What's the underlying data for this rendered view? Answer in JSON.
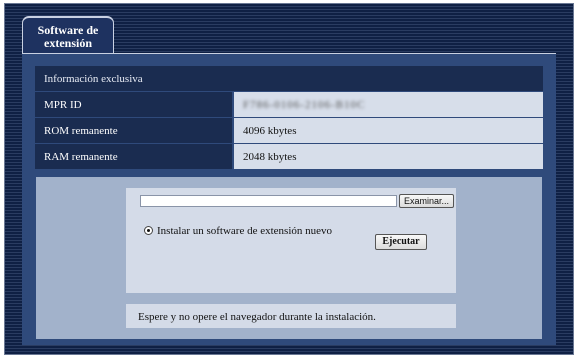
{
  "tab": {
    "title": "Software de extensión"
  },
  "info_table": {
    "header": "Información exclusiva",
    "rows": [
      {
        "label": "MPR ID",
        "value": "F786-0106-2106-B10C"
      },
      {
        "label": "ROM remanente",
        "value": "4096 kbytes"
      },
      {
        "label": "RAM remanente",
        "value": "2048 kbytes"
      }
    ]
  },
  "upload": {
    "file_value": "",
    "browse_label": "Examinar...",
    "option_label": "Instalar un software de extensión nuevo",
    "option_checked": true,
    "execute_label": "Ejecutar"
  },
  "notice": "Espere y no opere el navegador durante la instalación.",
  "colors": {
    "frame_dark": "#0f2044",
    "panel": "#2f4a7b",
    "header_cell": "#1a2c50",
    "value_cell": "#d7deea",
    "lower_area": "#a2b2cb"
  }
}
